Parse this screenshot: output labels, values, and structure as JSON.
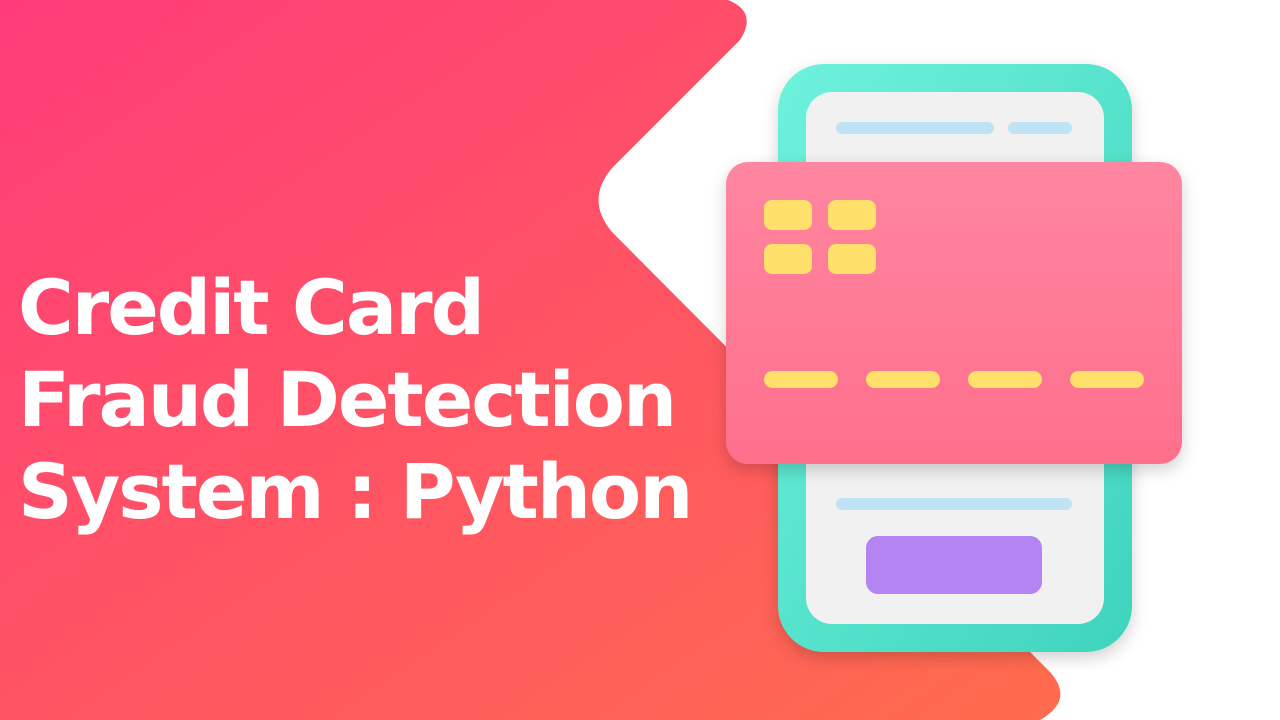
{
  "title": {
    "line1": "Credit Card",
    "line2": "Fraud Detection",
    "line3": "System : Python"
  },
  "colors": {
    "background": "#ffffff",
    "gradient_start": "#ff3c7a",
    "gradient_end": "#ff6c4d",
    "title_text": "#ffffff",
    "phone_body": "#56e6cf",
    "phone_screen": "#f1f1f1",
    "card": "#ff7e9b",
    "chip": "#ffe06a",
    "screen_line": "#bfe2f5",
    "phone_button": "#b484f2"
  },
  "icons": {
    "illustration": "phone-with-credit-card-icon"
  }
}
